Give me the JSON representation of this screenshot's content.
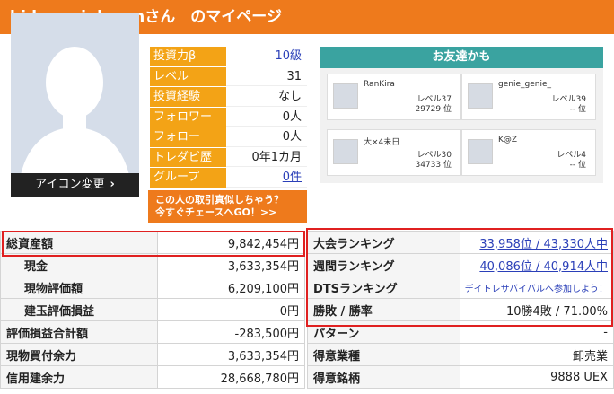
{
  "header": {
    "title": "hidamarinko-anさん　のマイページ"
  },
  "profile": {
    "icon_change_label": "アイコン変更",
    "stats": [
      {
        "label": "投資力β",
        "value": "10級",
        "link": true,
        "underline": false
      },
      {
        "label": "レベル",
        "value": "31"
      },
      {
        "label": "投資経験",
        "value": "なし"
      },
      {
        "label": "フォロワー",
        "value": "0人"
      },
      {
        "label": "フォロー",
        "value": "0人"
      },
      {
        "label": "トレダビ歴",
        "value": "0年1カ月"
      },
      {
        "label": "グループ",
        "value": "0件",
        "link": true,
        "underline": true
      }
    ],
    "chase_line1": "この人の取引真似しちゃう？",
    "chase_line2": "今すぐチェースへGO！>>"
  },
  "friends": {
    "title": "お友達かも",
    "items": [
      {
        "name": "RanKira",
        "level": "レベル37",
        "rank": "29729 位"
      },
      {
        "name": "genie_genie_",
        "level": "レベル39",
        "rank": "-- 位"
      },
      {
        "name": "大×4未日",
        "level": "レベル30",
        "rank": "34733 位"
      },
      {
        "name": "K@Z",
        "level": "レベル4",
        "rank": "-- 位"
      }
    ]
  },
  "assets": [
    {
      "label": "総資産額",
      "value": "9,842,454円",
      "sub": false
    },
    {
      "label": "現金",
      "value": "3,633,354円",
      "sub": true
    },
    {
      "label": "現物評価額",
      "value": "6,209,100円",
      "sub": true
    },
    {
      "label": "建玉評価損益",
      "value": "0円",
      "sub": true
    },
    {
      "label": "評価損益合計額",
      "value": "-283,500円",
      "sub": false
    },
    {
      "label": "現物買付余力",
      "value": "3,633,354円",
      "sub": false
    },
    {
      "label": "信用建余力",
      "value": "28,668,780円",
      "sub": false
    }
  ],
  "rankings": [
    {
      "label": "大会ランキング",
      "value": "33,958位 / 43,330人中",
      "link": true
    },
    {
      "label": "週間ランキング",
      "value": "40,086位 / 40,914人中",
      "link": true
    },
    {
      "label": "DTSランキング",
      "value": "デイトレサバイバルへ参加しよう！",
      "link": true,
      "small": true
    },
    {
      "label": "勝敗 / 勝率",
      "value": "10勝4敗 / 71.00%",
      "link": false
    },
    {
      "label": "パターン",
      "value": "-",
      "link": false
    },
    {
      "label": "得意業種",
      "value": "卸売業",
      "link": false
    },
    {
      "label": "得意銘柄",
      "value": "9888 UEX",
      "link": false
    }
  ]
}
